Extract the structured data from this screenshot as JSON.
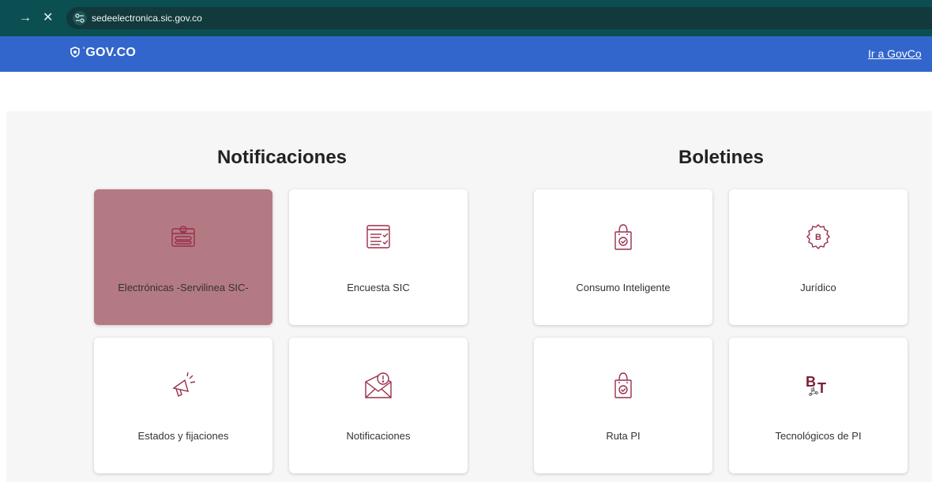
{
  "browser": {
    "url": "sedeelectronica.sic.gov.co",
    "forward_icon": "→",
    "stop_icon": "✕"
  },
  "gov_bar": {
    "logo_text": "GOV.CO",
    "link": "Ir a GovCo",
    "color": "#3366cc"
  },
  "sections": {
    "notificaciones": {
      "title": "Notificaciones",
      "cards": [
        {
          "label": "Electrónicas -Servilinea SIC-",
          "icon": "id-card-icon",
          "active": true
        },
        {
          "label": "Encuesta SIC",
          "icon": "survey-form-icon"
        },
        {
          "label": "Estados y fijaciones",
          "icon": "megaphone-icon"
        },
        {
          "label": "Notificaciones",
          "icon": "envelope-alert-icon"
        }
      ]
    },
    "boletines": {
      "title": "Boletines",
      "cards": [
        {
          "label": "Consumo Inteligente",
          "icon": "shopping-bag-check-icon"
        },
        {
          "label": "Jurídico",
          "icon": "badge-b-icon"
        },
        {
          "label": "Ruta PI",
          "icon": "shopping-bag-check-icon"
        },
        {
          "label": "Tecnológicos de PI",
          "icon": "bt-logo-icon",
          "logo_text": "BT"
        }
      ]
    }
  },
  "colors": {
    "icon": "#9a2f4a",
    "active_card": "#b47a83",
    "browser_bar": "#0c4f52"
  }
}
